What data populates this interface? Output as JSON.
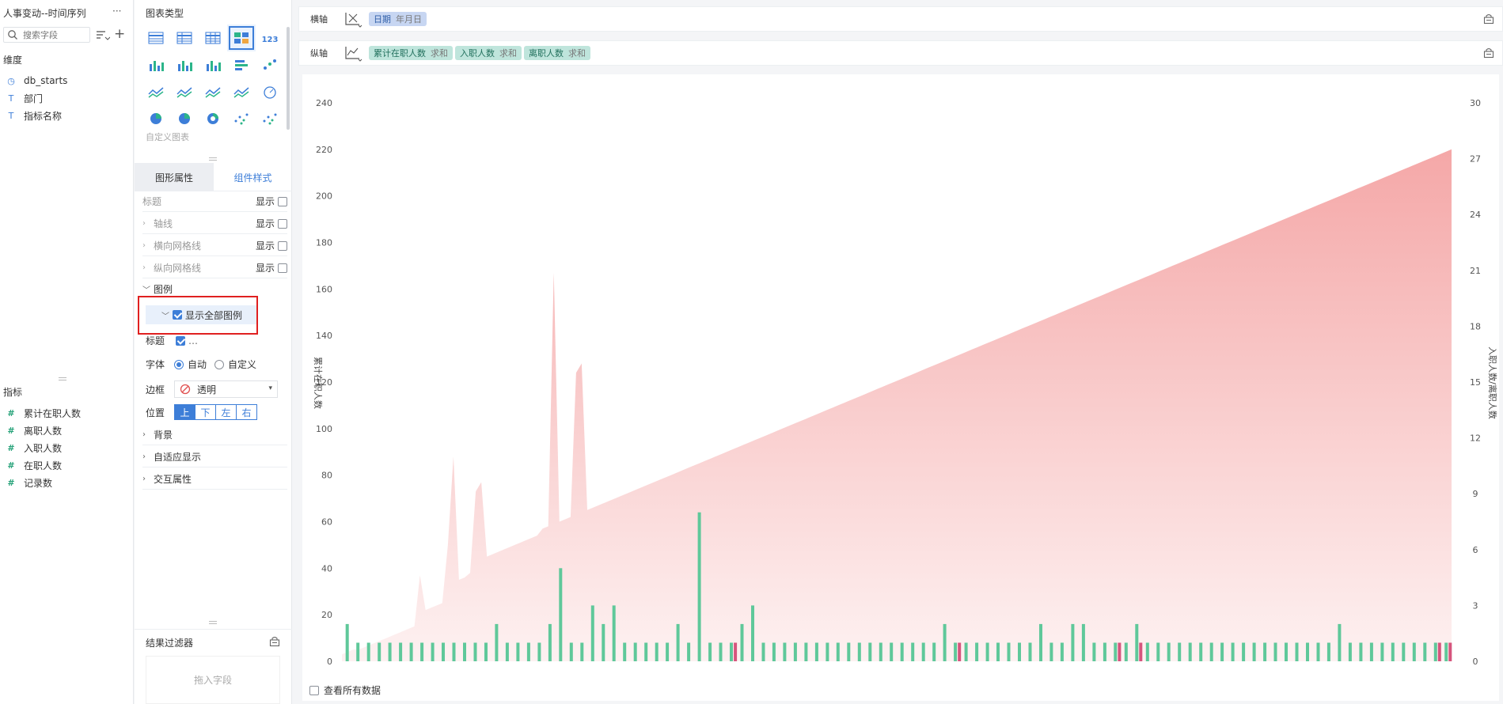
{
  "left_panel": {
    "title": "人事变动--时间序列",
    "more": "···",
    "search_placeholder": "搜索字段",
    "dimensions_label": "维度",
    "dimensions": [
      {
        "icon": "clock-icon",
        "glyph": "◷",
        "label": "db_starts"
      },
      {
        "icon": "text-type-icon",
        "glyph": "T",
        "label": "部门"
      },
      {
        "icon": "text-type-icon",
        "glyph": "T",
        "label": "指标名称"
      }
    ],
    "metrics_label": "指标",
    "metrics": [
      {
        "glyph": "#",
        "label": "累计在职人数"
      },
      {
        "glyph": "#",
        "label": "离职人数"
      },
      {
        "glyph": "#",
        "label": "入职人数"
      },
      {
        "glyph": "#",
        "label": "在职人数"
      },
      {
        "glyph": "#",
        "label": "记录数"
      }
    ]
  },
  "mid_panel": {
    "chart_type_label": "图表类型",
    "custom_chart_label": "自定义图表",
    "kpi_text": "123",
    "tabs": [
      "图形属性",
      "组件样式"
    ],
    "props": [
      {
        "label": "标题",
        "toggle": "显示"
      },
      {
        "label": "轴线",
        "toggle": "显示"
      },
      {
        "label": "横向网格线",
        "toggle": "显示"
      },
      {
        "label": "纵向网格线",
        "toggle": "显示"
      }
    ],
    "legend_label": "图例",
    "show_all_legend": "显示全部图例",
    "title_label": "标题",
    "title_more": "…",
    "font_label": "字体",
    "font_options": [
      "自动",
      "自定义"
    ],
    "border_label": "边框",
    "border_value": "透明",
    "position_label": "位置",
    "positions": [
      "上",
      "下",
      "左",
      "右"
    ],
    "sections": [
      "背景",
      "自适应显示",
      "交互属性"
    ],
    "filter_label": "结果过滤器",
    "drop_field": "拖入字段"
  },
  "shelves": {
    "x_label": "横轴",
    "x_fields": [
      {
        "name": "日期",
        "agg": "年月日"
      }
    ],
    "y_label": "纵轴",
    "y_fields": [
      {
        "name": "累计在职人数",
        "agg": "求和"
      },
      {
        "name": "入职人数",
        "agg": "求和"
      },
      {
        "name": "离职人数",
        "agg": "求和"
      }
    ]
  },
  "footer": {
    "view_all": "查看所有数据"
  },
  "colors": {
    "accent": "#3d7ed8",
    "area": "#f4a3a3",
    "bar_green": "#5fc89a",
    "bar_pink": "#d6557d",
    "highlight": "#e02020"
  },
  "chart_data": {
    "type": "area",
    "ylabel_left": "累计在职人数",
    "ylabel_right": "入职人数/离职人数",
    "yticks_left": [
      0,
      20,
      40,
      60,
      80,
      100,
      120,
      140,
      160,
      180,
      200,
      220,
      240
    ],
    "yticks_right": [
      0,
      3,
      6,
      9,
      12,
      15,
      18,
      21,
      24,
      27,
      30
    ],
    "ylim_left": [
      0,
      240
    ],
    "ylim_right": [
      0,
      30
    ],
    "series": [
      {
        "name": "累计在职人数",
        "kind": "area",
        "values": [
          3,
          4,
          5,
          5,
          6,
          7,
          8,
          9,
          10,
          11,
          12,
          13,
          14,
          15,
          37,
          22,
          23,
          24,
          25,
          50,
          88,
          35,
          36,
          38,
          73,
          77,
          45,
          46,
          47,
          48,
          49,
          50,
          51,
          52,
          53,
          54,
          57,
          58,
          167,
          60,
          61,
          62,
          124,
          128,
          65,
          66,
          67,
          68,
          69,
          70,
          71,
          72,
          73,
          74,
          75,
          76,
          77,
          78,
          79,
          80,
          81,
          82,
          83,
          84,
          85,
          86,
          87,
          88,
          89,
          90,
          91,
          92,
          93,
          94,
          95,
          96,
          97,
          98,
          99,
          100,
          101,
          102,
          103,
          104,
          105,
          106,
          107,
          108,
          109,
          110,
          111,
          112,
          113,
          114,
          115,
          116,
          117,
          118,
          119,
          120,
          121,
          122,
          123,
          124,
          125,
          126,
          127,
          128,
          129,
          130,
          131,
          132,
          133,
          134,
          135,
          136,
          137,
          138,
          139,
          140,
          141,
          142,
          143,
          144,
          145,
          146,
          147,
          148,
          149,
          150,
          151,
          152,
          153,
          154,
          155,
          156,
          157,
          158,
          159,
          160,
          161,
          162,
          163,
          164,
          165,
          166,
          167,
          168,
          169,
          170,
          171,
          172,
          173,
          174,
          175,
          176,
          177,
          178,
          179,
          180,
          181,
          182,
          183,
          184,
          185,
          186,
          187,
          188,
          189,
          190,
          191,
          192,
          193,
          194,
          195,
          196,
          197,
          198,
          199,
          200,
          201,
          202,
          203,
          204,
          205,
          206,
          207,
          208,
          209,
          210,
          211,
          212,
          213,
          214,
          215,
          216,
          217,
          218,
          219,
          220
        ]
      },
      {
        "name": "入职人数",
        "kind": "bar",
        "values": [
          2,
          1,
          1,
          1,
          1,
          1,
          1,
          1,
          1,
          1,
          1,
          1,
          1,
          1,
          2,
          1,
          1,
          1,
          1,
          2,
          5,
          1,
          1,
          3,
          2,
          3,
          1,
          1,
          1,
          1,
          1,
          2,
          1,
          8,
          1,
          1,
          1,
          2,
          3,
          1,
          1,
          1,
          1,
          1,
          1,
          1,
          1,
          1,
          1,
          1,
          1,
          1,
          1,
          1,
          1,
          1,
          2,
          1,
          1,
          1,
          1,
          1,
          1,
          1,
          1,
          2,
          1,
          1,
          2,
          2,
          1,
          1,
          1,
          1,
          2,
          1,
          1,
          1,
          1,
          1,
          1,
          1,
          1,
          1,
          1,
          1,
          1,
          1,
          1,
          1,
          1,
          1,
          1,
          2,
          1,
          1,
          1,
          1,
          1,
          1,
          1,
          1,
          1,
          1
        ]
      },
      {
        "name": "离职人数",
        "kind": "bar",
        "values": [
          0,
          0,
          0,
          0,
          0,
          0,
          0,
          0,
          0,
          0,
          0,
          0,
          0,
          0,
          0,
          0,
          0,
          0,
          0,
          0,
          0,
          0,
          0,
          0,
          0,
          0,
          0,
          0,
          0,
          0,
          0,
          0,
          0,
          0,
          0,
          0,
          1,
          0,
          0,
          0,
          0,
          0,
          0,
          0,
          0,
          0,
          0,
          0,
          0,
          0,
          0,
          0,
          0,
          0,
          0,
          0,
          0,
          1,
          0,
          0,
          0,
          0,
          0,
          0,
          0,
          0,
          0,
          0,
          0,
          0,
          0,
          0,
          1,
          0,
          1,
          0,
          0,
          0,
          0,
          0,
          0,
          0,
          0,
          0,
          0,
          0,
          0,
          0,
          0,
          0,
          0,
          0,
          0,
          0,
          0,
          0,
          0,
          0,
          0,
          0,
          0,
          0,
          1,
          1
        ]
      }
    ]
  }
}
